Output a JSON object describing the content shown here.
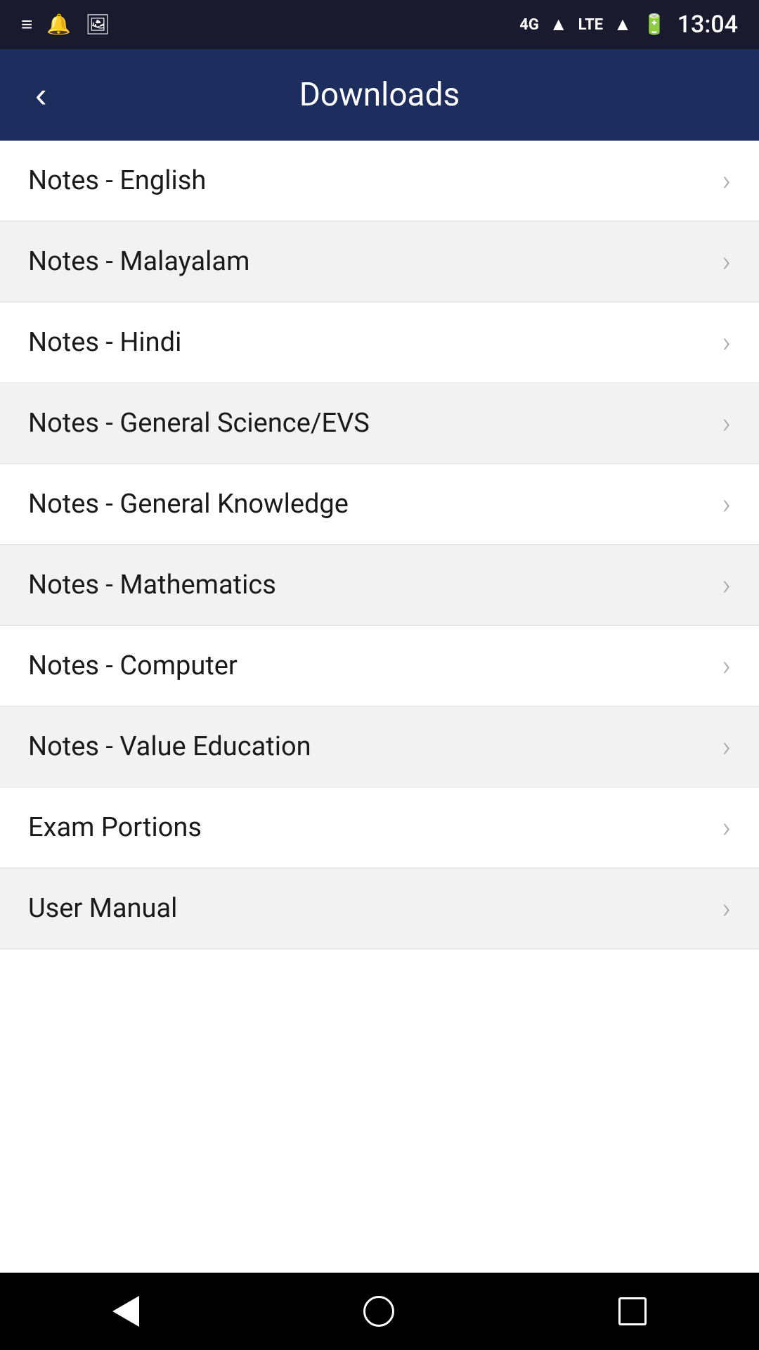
{
  "statusBar": {
    "time": "13:04",
    "icons": {
      "menu": "≡",
      "notification": "🔔",
      "image": "🖼",
      "signal4g": "4G",
      "lte": "LTE",
      "battery": "🔋"
    }
  },
  "header": {
    "title": "Downloads",
    "backLabel": "‹"
  },
  "listItems": [
    {
      "id": "notes-english",
      "label": "Notes - English"
    },
    {
      "id": "notes-malayalam",
      "label": "Notes - Malayalam"
    },
    {
      "id": "notes-hindi",
      "label": "Notes - Hindi"
    },
    {
      "id": "notes-general-science",
      "label": "Notes - General Science/EVS"
    },
    {
      "id": "notes-general-knowledge",
      "label": "Notes - General Knowledge"
    },
    {
      "id": "notes-mathematics",
      "label": "Notes - Mathematics"
    },
    {
      "id": "notes-computer",
      "label": "Notes - Computer"
    },
    {
      "id": "notes-value-education",
      "label": "Notes - Value Education"
    },
    {
      "id": "exam-portions",
      "label": "Exam Portions"
    },
    {
      "id": "user-manual",
      "label": "User Manual"
    }
  ],
  "bottomNav": {
    "back": "back",
    "home": "home",
    "recents": "recents"
  }
}
